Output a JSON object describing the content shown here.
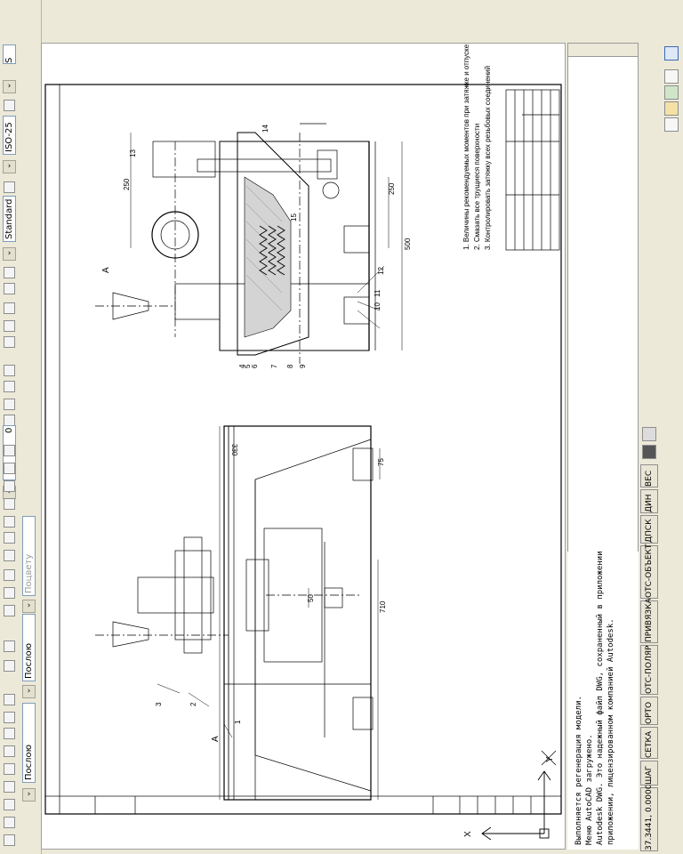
{
  "toolbar": {
    "layer_value": "0",
    "linetype_label": "Послою",
    "lineweight_label": "Послою",
    "color_label": "Поцвету",
    "textstyle_value": "Standard",
    "dimstyle_value": "ISO-25",
    "extra_value": "S"
  },
  "drawing": {
    "notes": [
      "1. Величины рекомендуемых моментов при затяжке и отпуске:",
      "2. Смазать все трущиеся поверхности",
      "3. Контролировать затяжку всех резьбовых соединений"
    ],
    "dims": {
      "d500": "500",
      "d250a": "250",
      "d250b": "250",
      "d330": "330",
      "d75": "75",
      "d50": "50",
      "d710": "710"
    },
    "labels": {
      "view_a": "А",
      "view_a2": "А",
      "p1": "1",
      "p2": "2",
      "p3": "3",
      "p4": "4",
      "p5": "5",
      "p6": "6",
      "p7": "7",
      "p8": "8",
      "p9": "9",
      "p10": "10",
      "p11": "11",
      "p12": "12",
      "p13": "13",
      "p14": "14",
      "p15": "15"
    },
    "axis_x": "X",
    "axis_y": "Y"
  },
  "command_line": [
    "Выполняется регенерация модели.",
    "Меню AutoCAD загружено.",
    "Autodesk DWG. Это надежный файл DWG, сохраненный в приложении Autodesk или",
    "приложении, лицензированном компанией Autodesk."
  ],
  "status": {
    "coords": "37.3441, 0.0000",
    "buttons": [
      "ШАГ",
      "СЕТКА",
      "ОРТО",
      "ОТС-ПОЛЯР",
      "ПРИВЯЗКА",
      "ОТС-ОБЪЕКТ",
      "ДПСК",
      "ДИН",
      "ВЕС"
    ]
  }
}
